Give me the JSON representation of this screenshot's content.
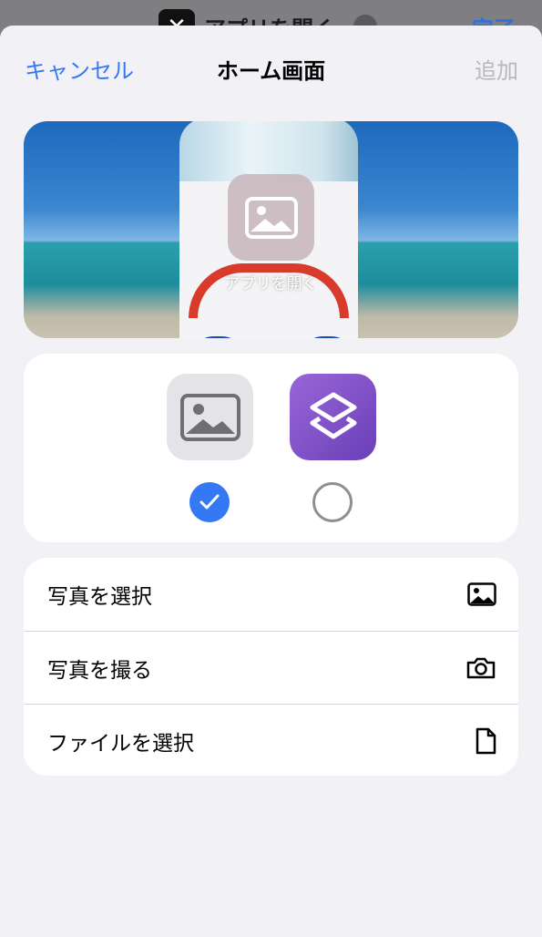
{
  "underlay": {
    "title": "アプリを開く",
    "done_label": "完了"
  },
  "nav": {
    "cancel_label": "キャンセル",
    "title": "ホーム画面",
    "add_label": "追加"
  },
  "preview": {
    "app_name_label": "アプリを開く"
  },
  "icon_options": [
    {
      "name": "photo-placeholder",
      "selected": true
    },
    {
      "name": "shortcuts-app-icon",
      "selected": false
    }
  ],
  "actions": [
    {
      "label": "写真を選択",
      "icon": "photo-icon"
    },
    {
      "label": "写真を撮る",
      "icon": "camera-icon"
    },
    {
      "label": "ファイルを選択",
      "icon": "document-icon"
    }
  ],
  "colors": {
    "accent": "#3478f6",
    "disabled": "#b7b7bc",
    "background": "#f2f2f6"
  }
}
